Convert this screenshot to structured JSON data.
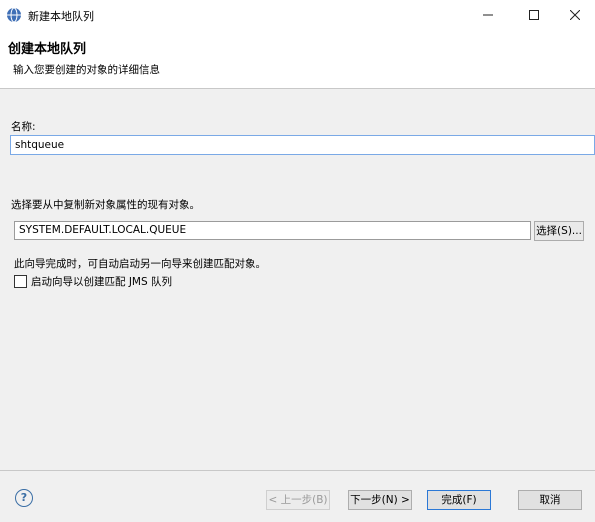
{
  "window": {
    "title": "新建本地队列",
    "icon": "mq-globe-icon"
  },
  "header": {
    "title": "创建本地队列",
    "description": "输入您要创建的对象的详细信息"
  },
  "form": {
    "name_label": "名称:",
    "name_value": "shtqueue",
    "copy_label": "选择要从中复制新对象属性的现有对象。",
    "copy_value": "SYSTEM.DEFAULT.LOCAL.QUEUE",
    "select_button": "选择(S)...",
    "hint": "此向导完成时，可自动启动另一向导来创建匹配对象。",
    "checkbox_label": "启动向导以创建匹配 JMS 队列",
    "checkbox_checked": false
  },
  "footer": {
    "back": "< 上一步(B)",
    "next": "下一步(N) >",
    "finish": "完成(F)",
    "cancel": "取消"
  }
}
